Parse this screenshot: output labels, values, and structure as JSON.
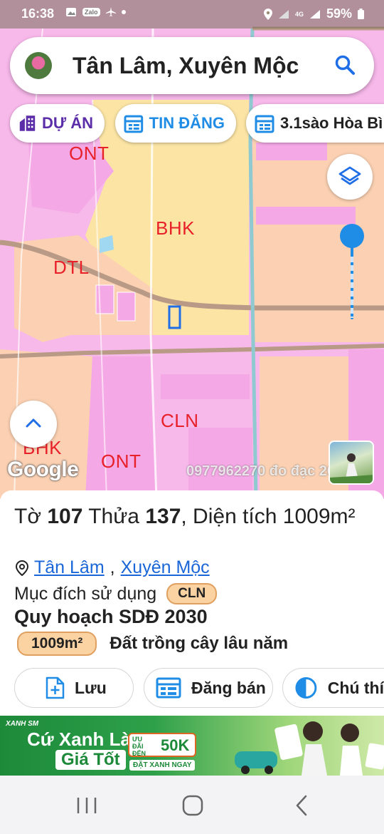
{
  "status_bar": {
    "time": "16:38",
    "network": "4G",
    "battery": "59%",
    "icons": [
      "image-icon",
      "zalo-icon",
      "airplane-icon",
      "dot-icon",
      "location-icon",
      "signal-icon",
      "signal-icon",
      "battery-icon"
    ],
    "zalo_label": "Zalo"
  },
  "search": {
    "query": "Tân Lâm, Xuyên Mộc"
  },
  "chips": [
    {
      "label": "DỰ ÁN",
      "icon": "building-icon",
      "color": "#5b2da8"
    },
    {
      "label": "TIN ĐĂNG",
      "icon": "calendar-icon",
      "color": "#1f8ce6"
    },
    {
      "label": "3.1sào Hòa Bì",
      "icon": "calendar-icon",
      "color": "#222222"
    }
  ],
  "map": {
    "zone_labels": [
      "ONT",
      "BHK",
      "DTL",
      "CLN",
      "BHK",
      "ONT"
    ],
    "google": "Google",
    "watermark": "0977962270 đo đạc 2030",
    "colors": {
      "residential": "#f7b8ea",
      "annual_crop": "#fbe4a4",
      "perennial": "#fcd1b3",
      "road": "#b89a86"
    }
  },
  "parcel": {
    "sheet_label": "Tờ",
    "sheet": "107",
    "plot_label": "Thửa",
    "plot": "137",
    "area_label": ", Diện tích",
    "area": "1009m²",
    "commune": "Tân Lâm",
    "district": "Xuyên Mộc",
    "usage_label": "Mục đích sử dụng",
    "usage_code": "CLN",
    "plan_title": "Quy hoạch SDĐ 2030",
    "plan_area": "1009m²",
    "plan_desc": "Đất trồng cây lâu năm"
  },
  "actions": [
    {
      "label": "Lưu",
      "icon": "add-file-icon"
    },
    {
      "label": "Đăng bán",
      "icon": "listing-icon"
    },
    {
      "label": "Chú thí",
      "icon": "legend-icon"
    }
  ],
  "ad": {
    "brand": "XANH SM",
    "line1": "Cứ Xanh Là",
    "line2": "Giá Tốt",
    "promo_small": "ƯU ĐÃI ĐẾN",
    "promo_value": "50K",
    "cta": "ĐẶT XANH NGAY"
  },
  "nav": [
    "recent-apps-icon",
    "home-icon",
    "back-icon"
  ]
}
